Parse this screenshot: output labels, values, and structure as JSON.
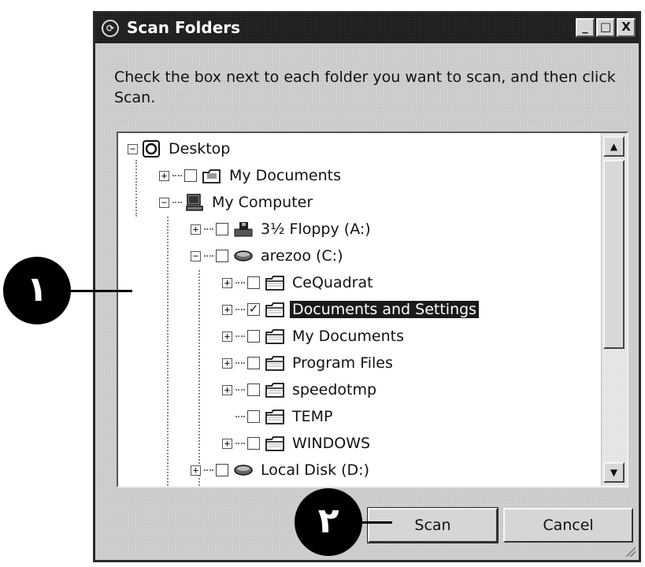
{
  "window": {
    "title": "Scan Folders",
    "minimize": "_",
    "maximize": "□",
    "close": "X"
  },
  "instruction": "Check the box next to each folder you want to scan, and then click Scan.",
  "tree": {
    "items": [
      {
        "label": "Desktop",
        "expander": "−",
        "checkbox": false,
        "checked": false,
        "icon": "desktop-icon"
      },
      {
        "label": "My Documents",
        "expander": "+",
        "checkbox": true,
        "checked": false,
        "icon": "documents-folder-icon"
      },
      {
        "label": "My Computer",
        "expander": "−",
        "checkbox": false,
        "checked": false,
        "icon": "computer-icon"
      },
      {
        "label": "3½ Floppy (A:)",
        "expander": "+",
        "checkbox": true,
        "checked": false,
        "icon": "floppy-drive-icon"
      },
      {
        "label": "arezoo (C:)",
        "expander": "−",
        "checkbox": true,
        "checked": false,
        "icon": "hard-drive-icon"
      },
      {
        "label": "CeQuadrat",
        "expander": "+",
        "checkbox": true,
        "checked": false,
        "icon": "folder-icon"
      },
      {
        "label": "Documents and Settings",
        "expander": "+",
        "checkbox": true,
        "checked": true,
        "selected": true,
        "icon": "folder-icon"
      },
      {
        "label": "My Documents",
        "expander": "+",
        "checkbox": true,
        "checked": false,
        "icon": "folder-icon"
      },
      {
        "label": "Program Files",
        "expander": "+",
        "checkbox": true,
        "checked": false,
        "icon": "folder-icon"
      },
      {
        "label": "speedotmp",
        "expander": "+",
        "checkbox": true,
        "checked": false,
        "icon": "folder-icon"
      },
      {
        "label": "TEMP",
        "expander": "",
        "checkbox": true,
        "checked": false,
        "icon": "folder-icon"
      },
      {
        "label": "WINDOWS",
        "expander": "+",
        "checkbox": true,
        "checked": false,
        "icon": "folder-icon"
      },
      {
        "label": "Local Disk (D:)",
        "expander": "+",
        "checkbox": true,
        "checked": false,
        "icon": "hard-drive-icon"
      }
    ],
    "checkmark": "✓"
  },
  "buttons": {
    "scan": "Scan",
    "cancel": "Cancel"
  },
  "callouts": {
    "one": "١",
    "two": "٢"
  },
  "scrollbar": {
    "up": "▲",
    "down": "▼"
  }
}
